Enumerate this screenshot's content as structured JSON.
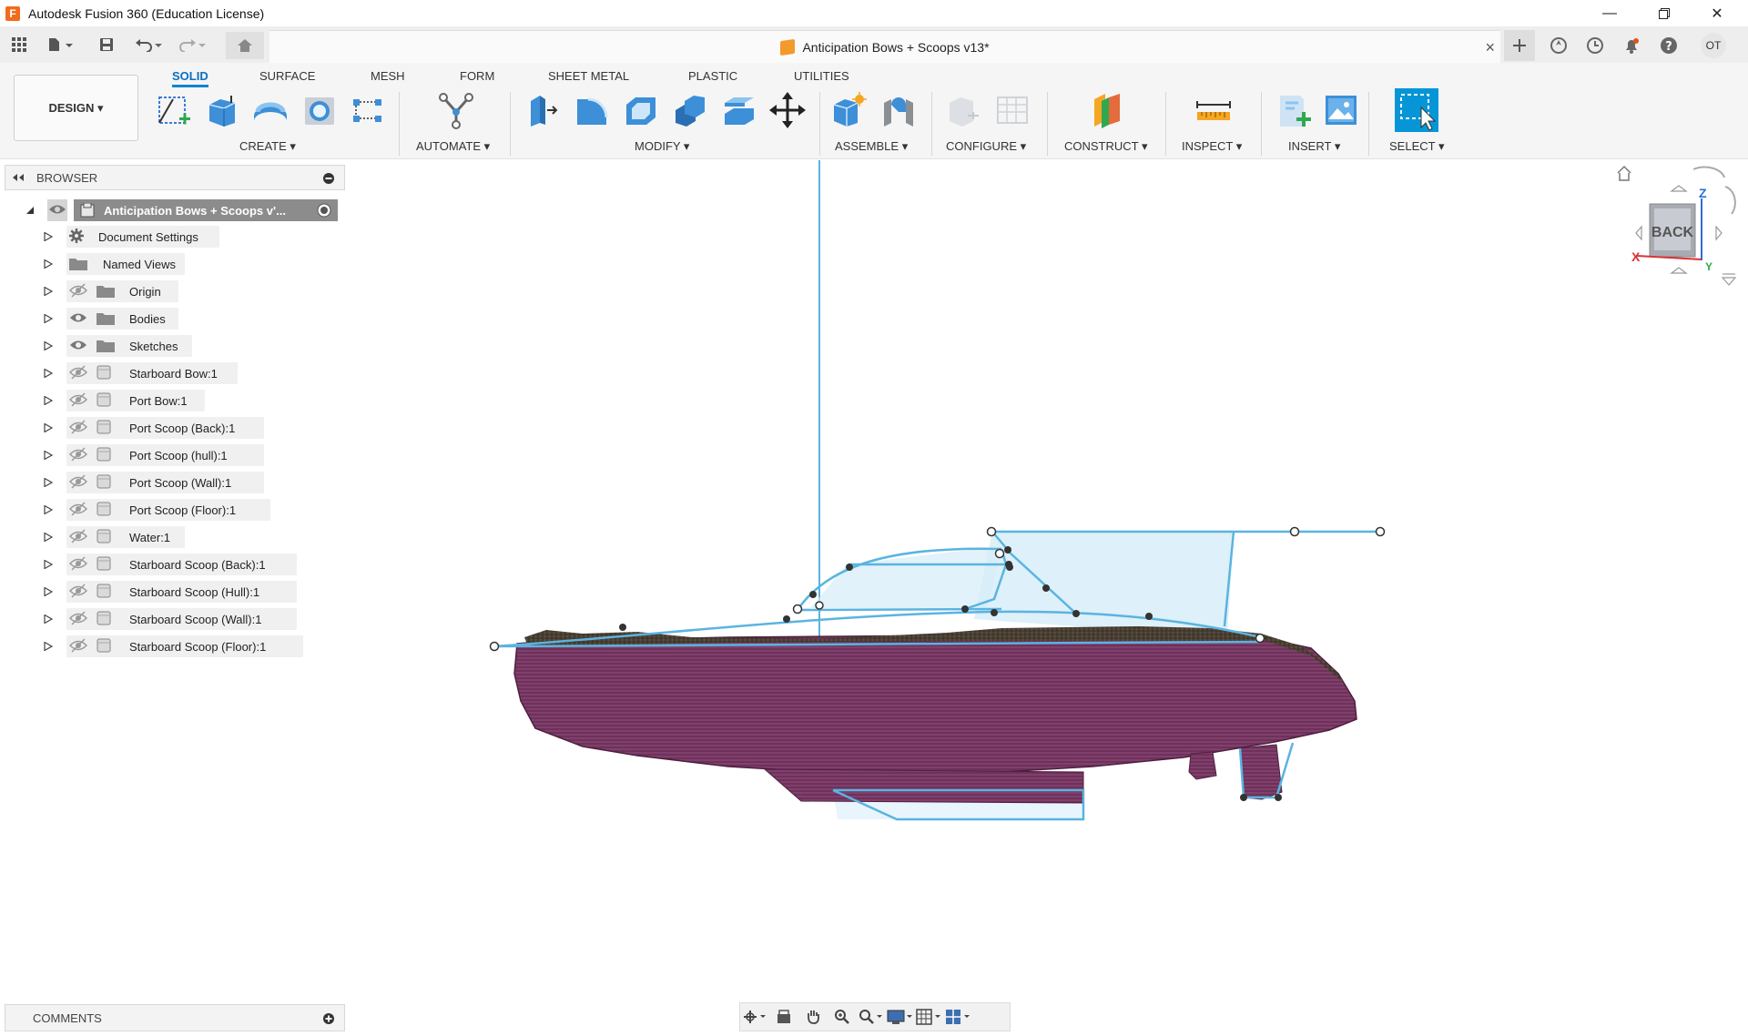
{
  "window": {
    "title": "Autodesk Fusion 360 (Education License)",
    "app_icon": "F",
    "controls": [
      "minimize-icon",
      "restore-icon",
      "close-icon"
    ]
  },
  "qat": {
    "document_tab": "Anticipation Bows + Scoops v13*",
    "close_tab": "×",
    "user_initials": "OT"
  },
  "toolbar": {
    "workspace": "DESIGN ▾",
    "tabs": [
      "SOLID",
      "SURFACE",
      "MESH",
      "FORM",
      "SHEET METAL",
      "PLASTIC",
      "UTILITIES"
    ],
    "active_tab": "SOLID",
    "groups": {
      "create": "CREATE ▾",
      "automate": "AUTOMATE ▾",
      "modify": "MODIFY ▾",
      "assemble": "ASSEMBLE ▾",
      "configure": "CONFIGURE ▾",
      "construct": "CONSTRUCT ▾",
      "inspect": "INSPECT ▾",
      "insert": "INSERT ▾",
      "select": "SELECT ▾"
    }
  },
  "browser": {
    "title": "BROWSER",
    "root": "Anticipation Bows + Scoops v'...",
    "items": [
      {
        "label": "Document Settings",
        "icon": "gear-icon",
        "eye": "none"
      },
      {
        "label": "Named Views",
        "icon": "folder-icon",
        "eye": "none"
      },
      {
        "label": "Origin",
        "icon": "folder-icon",
        "eye": "hidden"
      },
      {
        "label": "Bodies",
        "icon": "folder-icon",
        "eye": "visible"
      },
      {
        "label": "Sketches",
        "icon": "folder-icon",
        "eye": "visible"
      },
      {
        "label": "Starboard Bow:1",
        "icon": "body-icon",
        "eye": "hidden"
      },
      {
        "label": "Port Bow:1",
        "icon": "body-icon",
        "eye": "hidden"
      },
      {
        "label": "Port Scoop (Back):1",
        "icon": "body-icon",
        "eye": "hidden"
      },
      {
        "label": "Port Scoop (hull):1",
        "icon": "body-icon",
        "eye": "hidden"
      },
      {
        "label": "Port Scoop (Wall):1",
        "icon": "body-icon",
        "eye": "hidden"
      },
      {
        "label": "Port Scoop (Floor):1",
        "icon": "body-icon",
        "eye": "hidden"
      },
      {
        "label": "Water:1",
        "icon": "body-icon",
        "eye": "hidden"
      },
      {
        "label": "Starboard Scoop (Back):1",
        "icon": "body-icon",
        "eye": "hidden"
      },
      {
        "label": "Starboard Scoop (Hull):1",
        "icon": "body-icon",
        "eye": "hidden"
      },
      {
        "label": "Starboard Scoop (Wall):1",
        "icon": "body-icon",
        "eye": "hidden"
      },
      {
        "label": "Starboard Scoop (Floor):1",
        "icon": "body-icon",
        "eye": "hidden"
      }
    ]
  },
  "comments": {
    "title": "COMMENTS"
  },
  "viewcube": {
    "face": "BACK",
    "axis_x": "X",
    "axis_y": "Y",
    "axis_z": "Z"
  },
  "colors": {
    "accent": "#0a84d6",
    "sketch": "#5ab4e0",
    "hull": "#6e2f5c",
    "sketch_fill": "#d6ecf8"
  }
}
